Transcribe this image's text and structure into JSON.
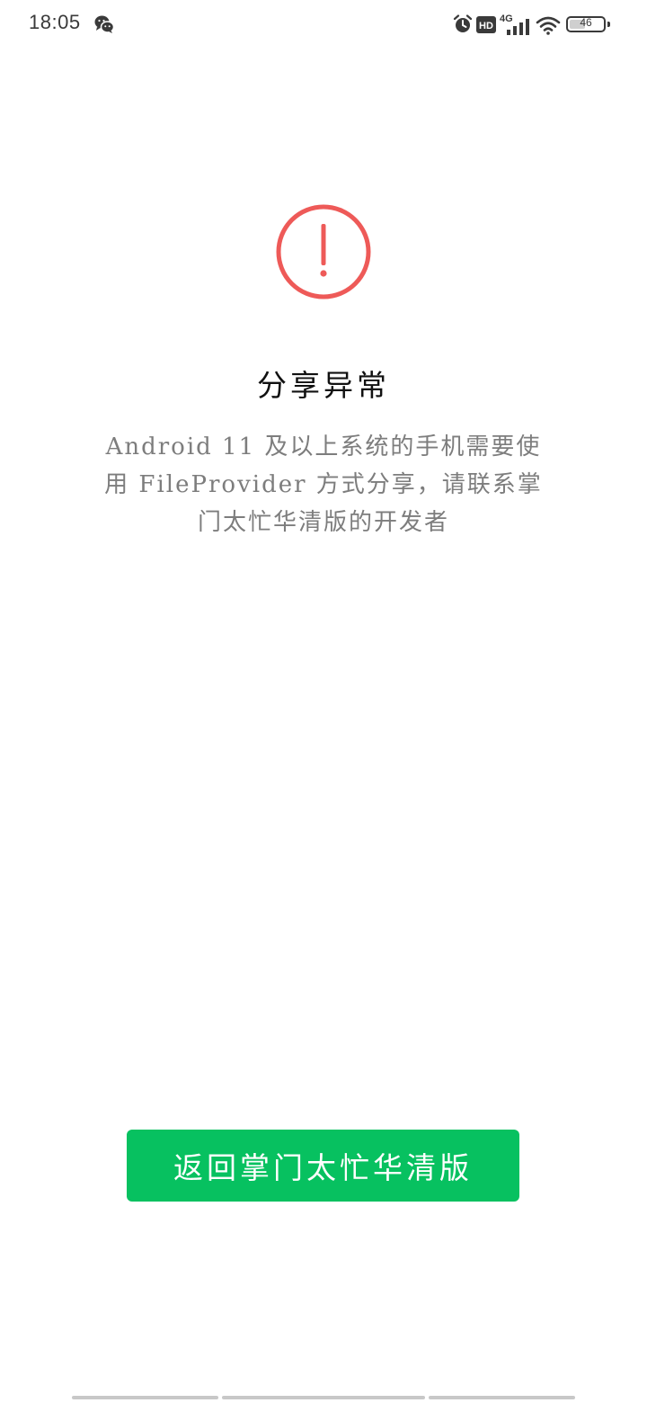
{
  "status_bar": {
    "time": "18:05",
    "network": "4G",
    "hd": "HD",
    "battery_level": "46",
    "battery_fraction": 0.46,
    "icons": [
      "wechat-icon",
      "alarm-icon",
      "hd-icon",
      "signal-icon",
      "wifi-icon",
      "battery-icon"
    ]
  },
  "error": {
    "icon": "exclamation-circle-icon",
    "icon_color": "#ee5a58",
    "title": "分享异常",
    "message": "Android 11 及以上系统的手机需要使用 FileProvider 方式分享，请联系掌门太忙华清版的开发者"
  },
  "actions": {
    "return_label": "返回掌门太忙华清版",
    "return_color": "#07c160"
  }
}
